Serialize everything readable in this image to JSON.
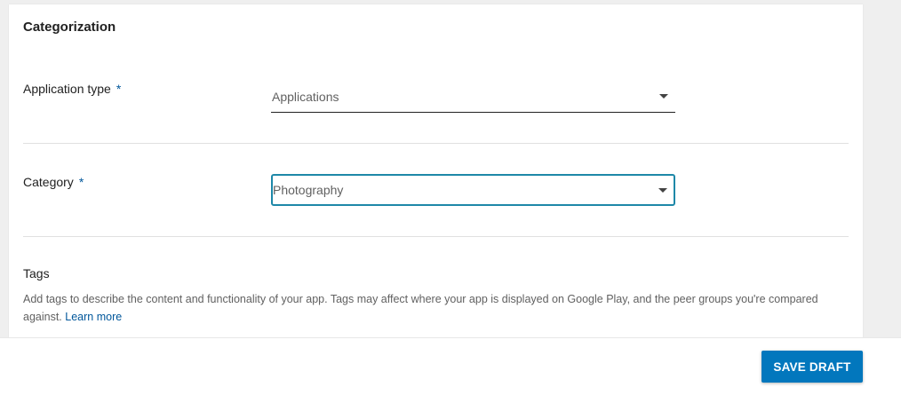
{
  "section": {
    "title": "Categorization"
  },
  "fields": {
    "application_type": {
      "label": "Application type",
      "required_mark": "*",
      "value": "Applications"
    },
    "category": {
      "label": "Category",
      "required_mark": "*",
      "value": "Photography"
    }
  },
  "tags": {
    "title": "Tags",
    "description": "Add tags to describe the content and functionality of your app. Tags may affect where your app is displayed on Google Play, and the peer groups you're compared against.",
    "learn_more": "Learn more"
  },
  "footer": {
    "save_label": "SAVE DRAFT"
  },
  "colors": {
    "accent": "#0277bd",
    "focus_border": "#1e88a8",
    "link": "#01579b"
  }
}
